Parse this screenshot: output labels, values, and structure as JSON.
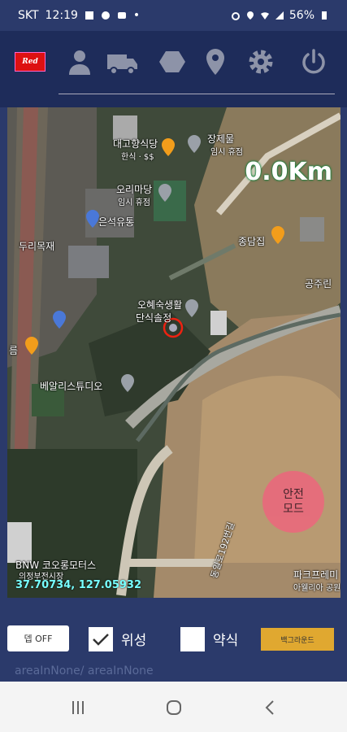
{
  "status_bar": {
    "carrier": "SKT",
    "time": "12:19",
    "dot": "•",
    "battery": "56%"
  },
  "toolbar": {
    "logo_text": "Red",
    "icons": [
      "user-icon",
      "truck-icon",
      "hexagon-icon",
      "location-pin-icon",
      "gear-icon",
      "power-icon"
    ]
  },
  "map": {
    "distance": "0.0Km",
    "coordinates": "37.70734, 127.05932",
    "labels": {
      "food1_line1": "대고향식당",
      "food1_line2": "한식 · $$",
      "jang_line1": "장제물",
      "jang_line2": "임시 휴점",
      "ori_line1": "오리마당",
      "ori_line2": "임시 휴점",
      "eunsei": "은석유통",
      "durimokja": "두리목재",
      "jongdamjip": "종담집",
      "gongju": "공주린",
      "ohye_line1": "오혜숙생활",
      "ohye_line2": "단식솔정",
      "ireum": "름",
      "bealri": "베알리스튜디오",
      "bnw_line1": "BNW 코오롱모터스",
      "bnw_line2": "의정부전시장",
      "road": "동일로192번길",
      "park_line1": "파크프레미",
      "park_line2": "아웰리아 공원"
    }
  },
  "safe_mode": {
    "line1": "안전",
    "line2": "모드"
  },
  "controls": {
    "off_button": "뎁 OFF",
    "satellite_label": "위성",
    "satellite_checked": true,
    "abbrev_label": "약식",
    "abbrev_checked": false,
    "background_button": "백그라운드"
  },
  "area_text": "areaInNone/ areaInNone",
  "colors": {
    "header": "#1e2c5a",
    "panel": "#2b3a6b",
    "accent": "#e0a830",
    "safe": "#e86a7c"
  }
}
